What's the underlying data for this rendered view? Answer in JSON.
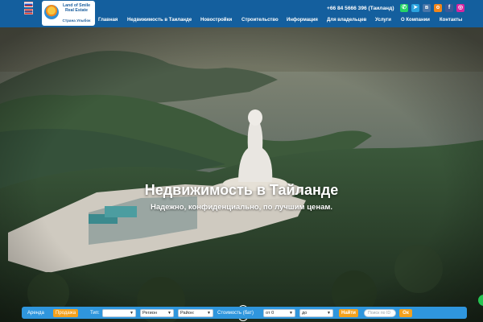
{
  "header": {
    "flags": [
      "flag-ru-icon",
      "flag-th-icon"
    ],
    "logo": {
      "line1": "Land of Smile",
      "line2": "Real Estate",
      "tagline": "Страна Улыбок"
    },
    "phone": "+66 84 5666 396 (Таиланд)",
    "socials": [
      {
        "name": "whatsapp-icon",
        "glyph": "✆",
        "color": "#25d366"
      },
      {
        "name": "telegram-icon",
        "glyph": "➤",
        "color": "#2aa3df"
      },
      {
        "name": "vk-icon",
        "glyph": "в",
        "color": "#4a76a8"
      },
      {
        "name": "odnoklassniki-icon",
        "glyph": "о",
        "color": "#f0851a"
      },
      {
        "name": "facebook-icon",
        "glyph": "f",
        "color": "#3b5998"
      },
      {
        "name": "instagram-icon",
        "glyph": "◎",
        "color": "#d6249f"
      }
    ],
    "nav": [
      "Главная",
      "Недвижимость в Таиланде",
      "Новостройки",
      "Строительство",
      "Информация",
      "Для владельцев",
      "Услуги",
      "О Компании",
      "Контакты"
    ]
  },
  "hero": {
    "title": "Недвижимость в Тайланде",
    "subtitle": "Надежно, конфиденциально, по лучшим ценам.",
    "scroll_icon": "chevron-down-icon"
  },
  "search": {
    "tabs": [
      "Аренда",
      "Продажа"
    ],
    "active_tab": "Продажа",
    "type_label": "Тип:",
    "type_value": "",
    "region_value": "Регион",
    "district_value": "Район:",
    "price_label": "Стоимость (бат)",
    "price_from": "от 0",
    "price_to": "до",
    "find_button": "Найти",
    "id_placeholder": "Поиск по ID",
    "ok_button": "Ок"
  },
  "colors": {
    "header_bg": "#145f9e",
    "search_bg": "#2f96dd",
    "accent": "#f4a11d",
    "chat": "#25c451"
  }
}
